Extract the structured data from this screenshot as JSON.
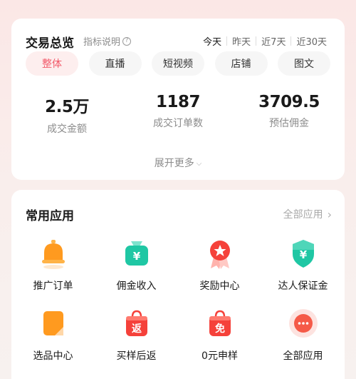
{
  "overview": {
    "title": "交易总览",
    "hint": "指标说明",
    "periods": [
      "今天",
      "昨天",
      "近7天",
      "近30天"
    ],
    "tabs": [
      "整体",
      "直播",
      "短视频",
      "店铺",
      "图文"
    ],
    "stats": [
      {
        "value": "2.5万",
        "label": "成交金额"
      },
      {
        "value": "1187",
        "label": "成交订单数"
      },
      {
        "value": "3709.5",
        "label": "预估佣金"
      }
    ],
    "more_label": "展开更多"
  },
  "apps": {
    "title": "常用应用",
    "all_label": "全部应用",
    "items": [
      {
        "label": "推广订单",
        "icon": "bell-icon"
      },
      {
        "label": "佣金收入",
        "icon": "money-bag-icon"
      },
      {
        "label": "奖励中心",
        "icon": "medal-icon"
      },
      {
        "label": "达人保证金",
        "icon": "shield-yen-icon"
      },
      {
        "label": "选品中心",
        "icon": "bookmark-icon"
      },
      {
        "label": "买样后返",
        "icon": "return-bag-icon",
        "badge": "返"
      },
      {
        "label": "0元申样",
        "icon": "free-bag-icon",
        "badge": "免"
      },
      {
        "label": "全部应用",
        "icon": "more-dots-icon"
      }
    ]
  },
  "colors": {
    "accent": "#f25a6a",
    "tab_active_bg": "#fdeeee",
    "orange": "#ff9a1f",
    "teal": "#1fc7a4",
    "red": "#f5413a"
  }
}
